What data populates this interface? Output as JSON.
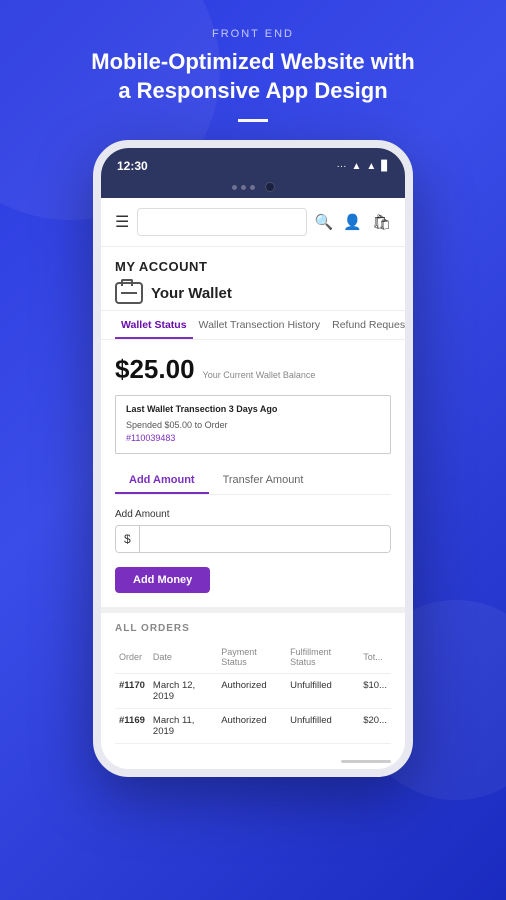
{
  "header": {
    "label": "FRONT END",
    "title": "Mobile-Optimized Website with a Responsive App Design"
  },
  "statusBar": {
    "time": "12:30",
    "icons": "... ▼ ▲ 🔋"
  },
  "navbar": {
    "searchPlaceholder": "",
    "icons": [
      "search",
      "user",
      "bag"
    ]
  },
  "page": {
    "accountLabel": "MY ACCOUNT",
    "walletTitle": "Your Wallet"
  },
  "tabs": {
    "items": [
      {
        "label": "Wallet Status",
        "active": true
      },
      {
        "label": "Wallet Transection History",
        "active": false
      },
      {
        "label": "Refund Request",
        "active": false
      }
    ]
  },
  "walletStatus": {
    "balance": "$25.00",
    "balanceLabel": "Your Current Wallet Balance",
    "lastTransactionTitle": "Last Wallet Transection 3 Days Ago",
    "lastTransactionDetail": "Spended $05.00 to Order",
    "lastTransactionLink": "#110039483"
  },
  "actionTabs": [
    {
      "label": "Add Amount",
      "active": true
    },
    {
      "label": "Transfer Amount",
      "active": false
    }
  ],
  "addAmountForm": {
    "label": "Add Amount",
    "prefix": "$",
    "placeholder": "",
    "buttonLabel": "Add Money"
  },
  "ordersSection": {
    "title": "ALL ORDERS",
    "columns": [
      "Order",
      "Date",
      "Payment Status",
      "Fulfillment Status",
      "Tot..."
    ],
    "rows": [
      {
        "order": "#1170",
        "date": "March 12, 2019",
        "paymentStatus": "Authorized",
        "fulfillmentStatus": "Unfulfilled",
        "total": "$10..."
      },
      {
        "order": "#1169",
        "date": "March 11, 2019",
        "paymentStatus": "Authorized",
        "fulfillmentStatus": "Unfulfilled",
        "total": "$20..."
      }
    ]
  }
}
